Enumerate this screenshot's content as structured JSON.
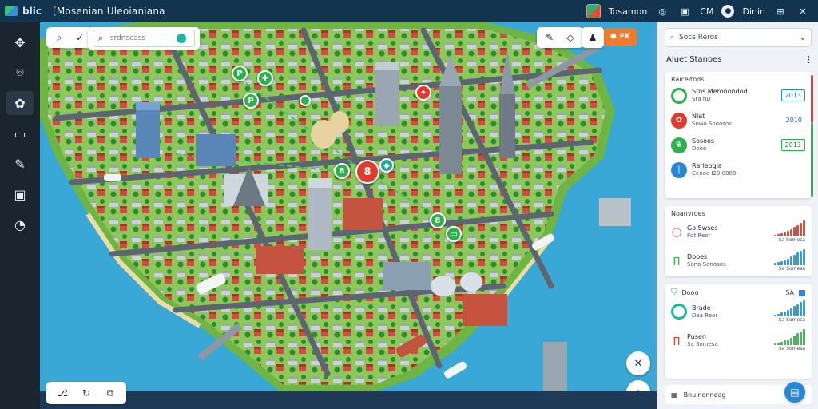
{
  "app": {
    "brand": "blic",
    "title": "[Mosenian Uleoianiana"
  },
  "topbar": {
    "user_label": "Tosamon",
    "view_label": "CM",
    "account_label": "Dinin"
  },
  "rail": {
    "items": [
      {
        "icon": "compass-icon",
        "glyph": "✥"
      },
      {
        "icon": "map-pin-icon",
        "glyph": "⌾"
      },
      {
        "icon": "layers-icon",
        "glyph": "✿"
      },
      {
        "icon": "panel-icon",
        "glyph": "▭"
      },
      {
        "icon": "pen-icon",
        "glyph": "✎"
      },
      {
        "icon": "calendar-icon",
        "glyph": "▣"
      },
      {
        "icon": "gauge-icon",
        "glyph": "◔"
      }
    ]
  },
  "map_toolbar": {
    "search_placeholder": "Isrdnscass",
    "action_label": "FK"
  },
  "panel": {
    "search_placeholder": "Socs Reros",
    "header": "Aluet Stanoes",
    "routes_card": {
      "title": "Raiceitods",
      "rows": [
        {
          "name": "Sros Meronondod",
          "sub": "Sra hD",
          "value": "2013",
          "style": "blue",
          "icon_color": "#2bb24c"
        },
        {
          "name": "Nlat",
          "sub": "Sowo Sooosos",
          "value": "2010",
          "style": "plain",
          "icon_color": "#e23a2e"
        },
        {
          "name": "Sosoos",
          "sub": "Dooo",
          "value": "2013",
          "style": "green",
          "icon_color": "#2bb24c"
        },
        {
          "name": "Rarleogia",
          "sub": "Cenoe I20 0000",
          "value": "",
          "style": "none",
          "icon_color": "#2a86d6"
        }
      ]
    },
    "stats_card": {
      "title": "Noanvroes",
      "rows": [
        {
          "name": "Go Swses",
          "sub": "Fdt Reor",
          "cap": "Sa Somesa",
          "color": "#e8473a",
          "bars": [
            2,
            3,
            4,
            5,
            7,
            9,
            12,
            14,
            17,
            20
          ]
        },
        {
          "name": "Dboes",
          "sub": "Sono Sonosos",
          "cap": "Sa Somesa",
          "color": "#1ea7e0",
          "bars": [
            3,
            4,
            5,
            6,
            8,
            10,
            12,
            15,
            17,
            19
          ]
        }
      ]
    },
    "third_card": {
      "title": "Dooo",
      "side": "SA",
      "rows": [
        {
          "name": "Brade",
          "sub": "Dea Reor",
          "cap": "Sa Somesa",
          "color": "#1ea7e0",
          "bars": [
            2,
            3,
            5,
            6,
            8,
            10,
            13,
            15,
            18,
            20
          ]
        },
        {
          "name": "Pusen",
          "sub": "Sa Somesa",
          "cap": "Sa Somesa",
          "color": "#3bbf4f",
          "bars": [
            2,
            3,
            4,
            6,
            7,
            9,
            11,
            14,
            16,
            19
          ]
        }
      ]
    },
    "footer_label": "Bnuinonneag"
  },
  "markers": {
    "main": "8",
    "labels": [
      "P",
      "P",
      "8",
      "8"
    ]
  },
  "colors": {
    "topbar": "#12344f",
    "rail": "#1b2530",
    "water": "#3aa8d6",
    "land": "#7cbf4a",
    "accent_orange": "#f07a2e",
    "accent_blue": "#2a86d6"
  }
}
